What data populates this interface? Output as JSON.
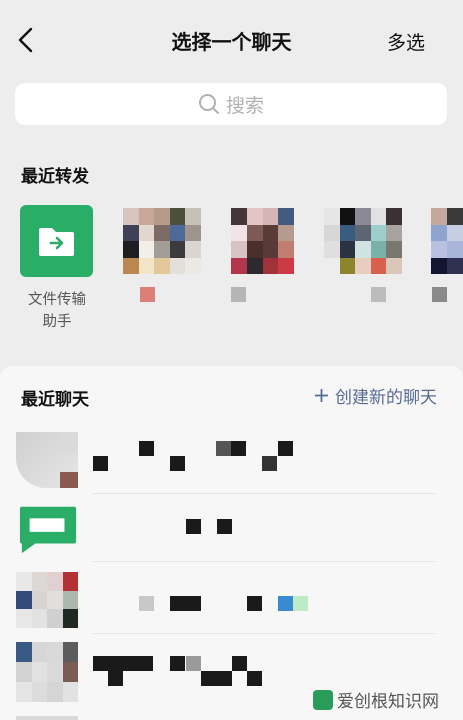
{
  "header": {
    "title": "选择一个聊天",
    "multi_select": "多选"
  },
  "search": {
    "placeholder": "搜索"
  },
  "recent_forward": {
    "title": "最近转发",
    "file_transfer_label": "文件传输助手"
  },
  "recent_chats": {
    "title": "最近聊天",
    "create_new": "创建新的聊天"
  },
  "watermark": {
    "text": "爱创根知识网"
  },
  "colors": {
    "wechat_green": "#2aae67",
    "link_blue": "#576b95",
    "background": "#ededed"
  }
}
